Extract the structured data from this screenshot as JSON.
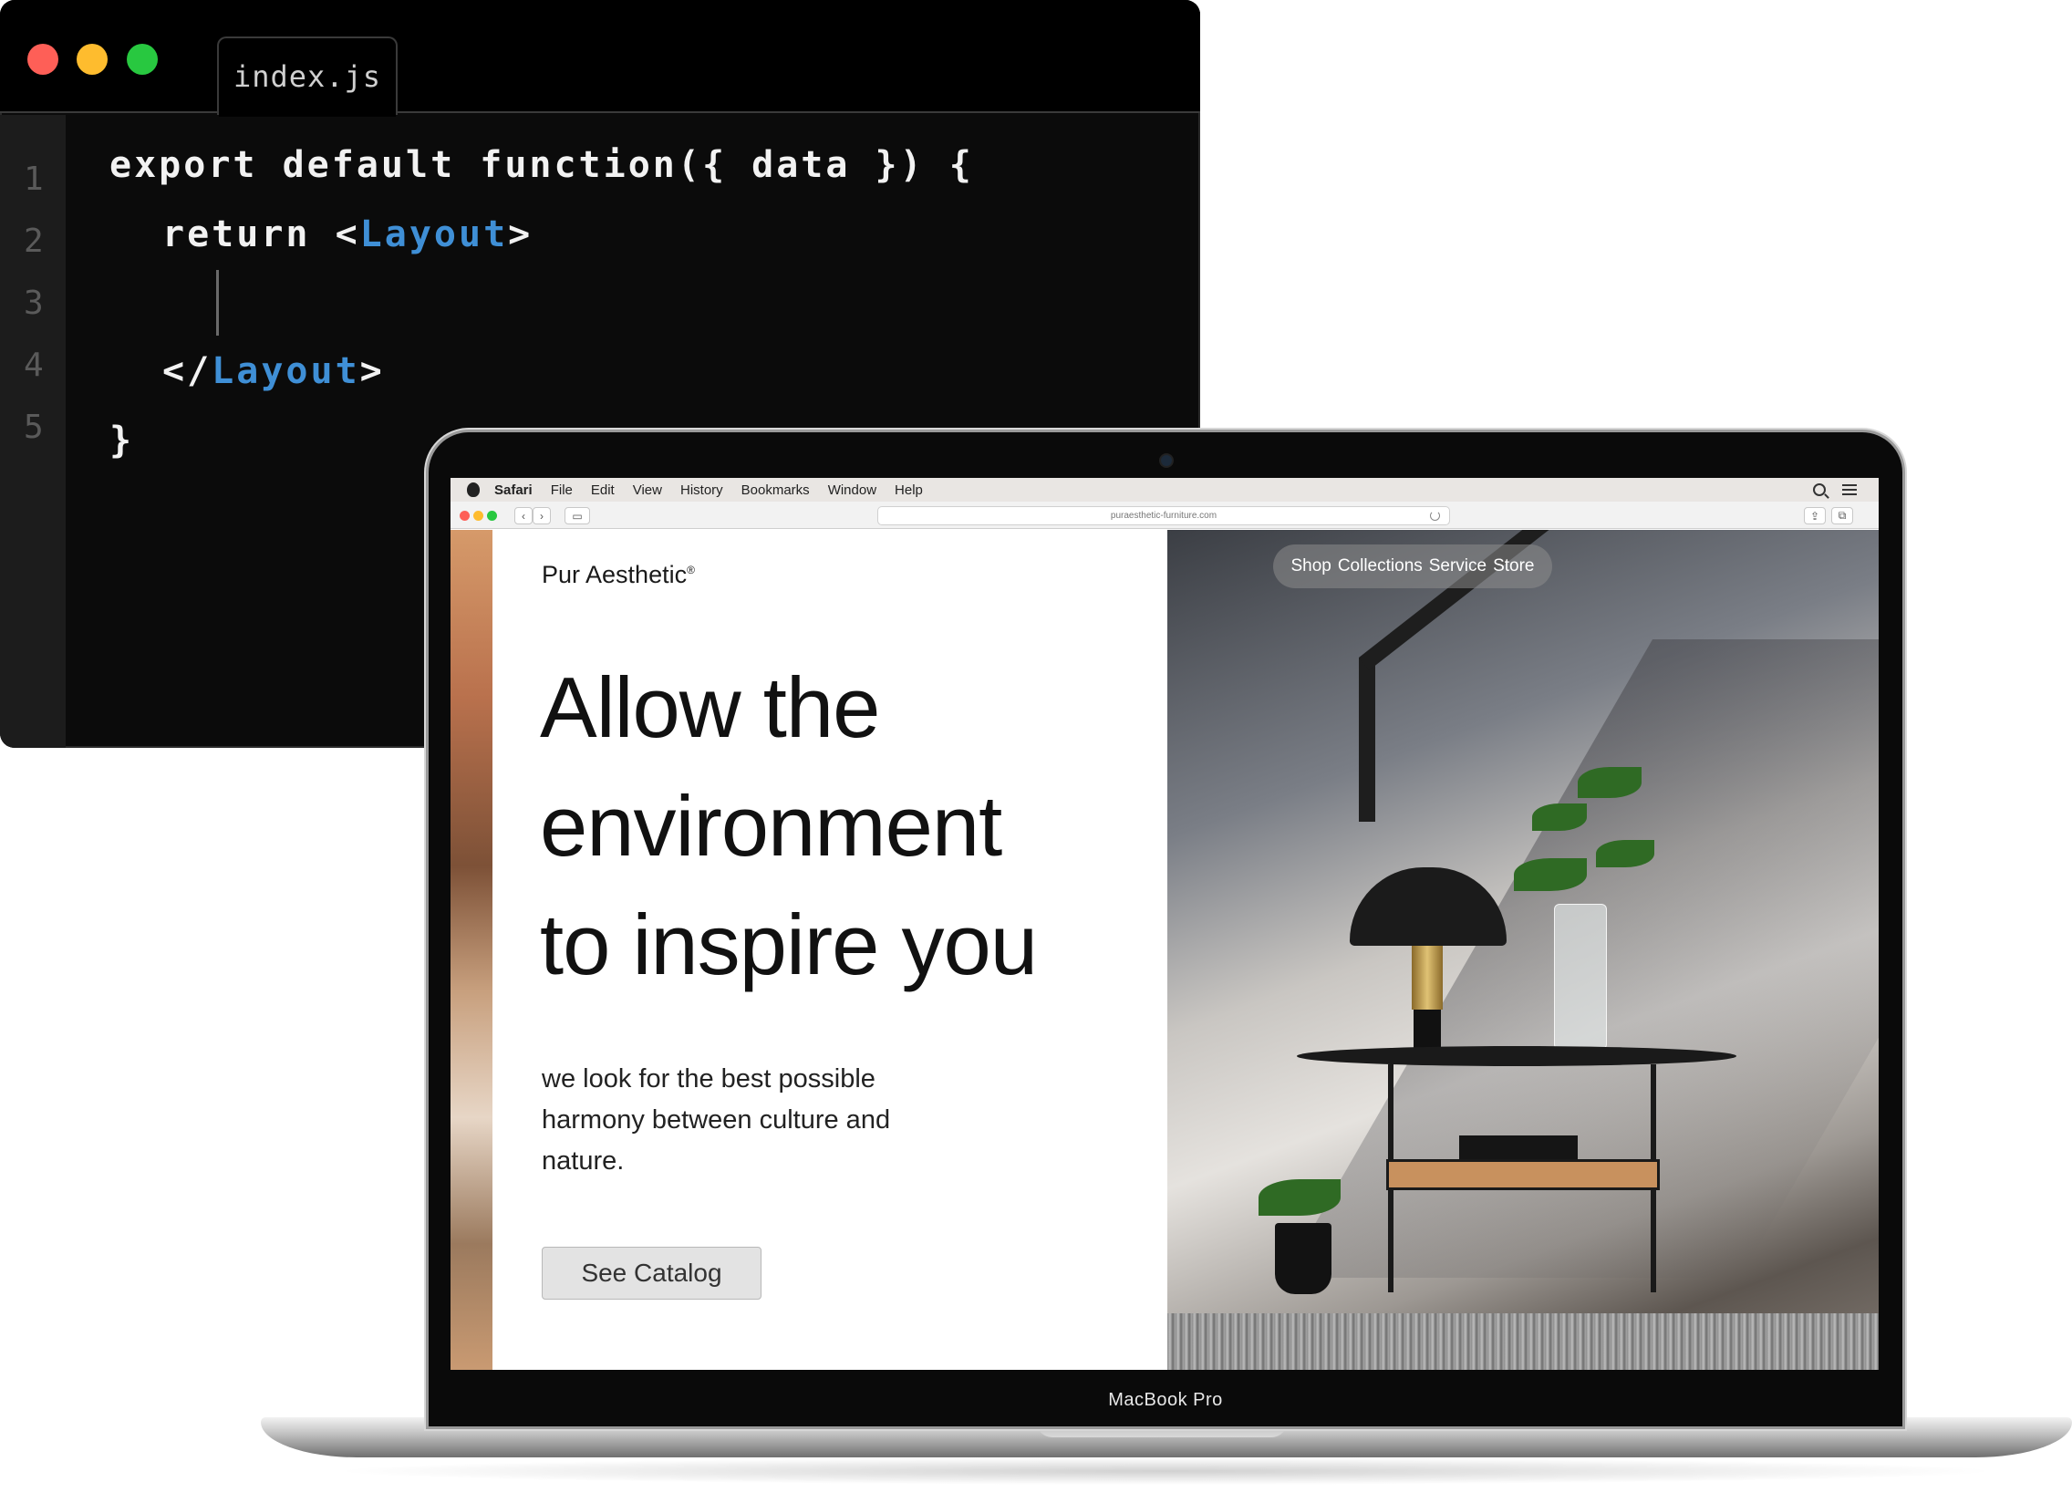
{
  "editor": {
    "tab_label": "index.js",
    "line_numbers": [
      "1",
      "2",
      "3",
      "4",
      "5"
    ],
    "code": {
      "line1": "export default function({ data }) {",
      "line2_keyword": "return <",
      "line2_tag": "Layout",
      "line2_end": ">",
      "line4_start": "</",
      "line4_tag": "Layout",
      "line4_end": ">",
      "line5": "}"
    },
    "colors": {
      "background": "#0b0b0b",
      "tag": "#3f8fd6",
      "text": "#f2f2f2"
    }
  },
  "menubar": {
    "app": "Safari",
    "items": [
      "File",
      "Edit",
      "View",
      "History",
      "Bookmarks",
      "Window",
      "Help"
    ]
  },
  "browser": {
    "url": "puraesthetic-furniture.com"
  },
  "website": {
    "brand": "Pur Aesthetic",
    "brand_mark": "®",
    "nav": [
      "Shop",
      "Collections",
      "Service",
      "Store"
    ],
    "headline": [
      "Allow the",
      "environment",
      "to inspire you"
    ],
    "tagline": [
      "we look for the best possible",
      "harmony between culture and",
      "nature."
    ],
    "cta_label": "See Catalog"
  },
  "device": {
    "model_label": "MacBook Pro"
  }
}
